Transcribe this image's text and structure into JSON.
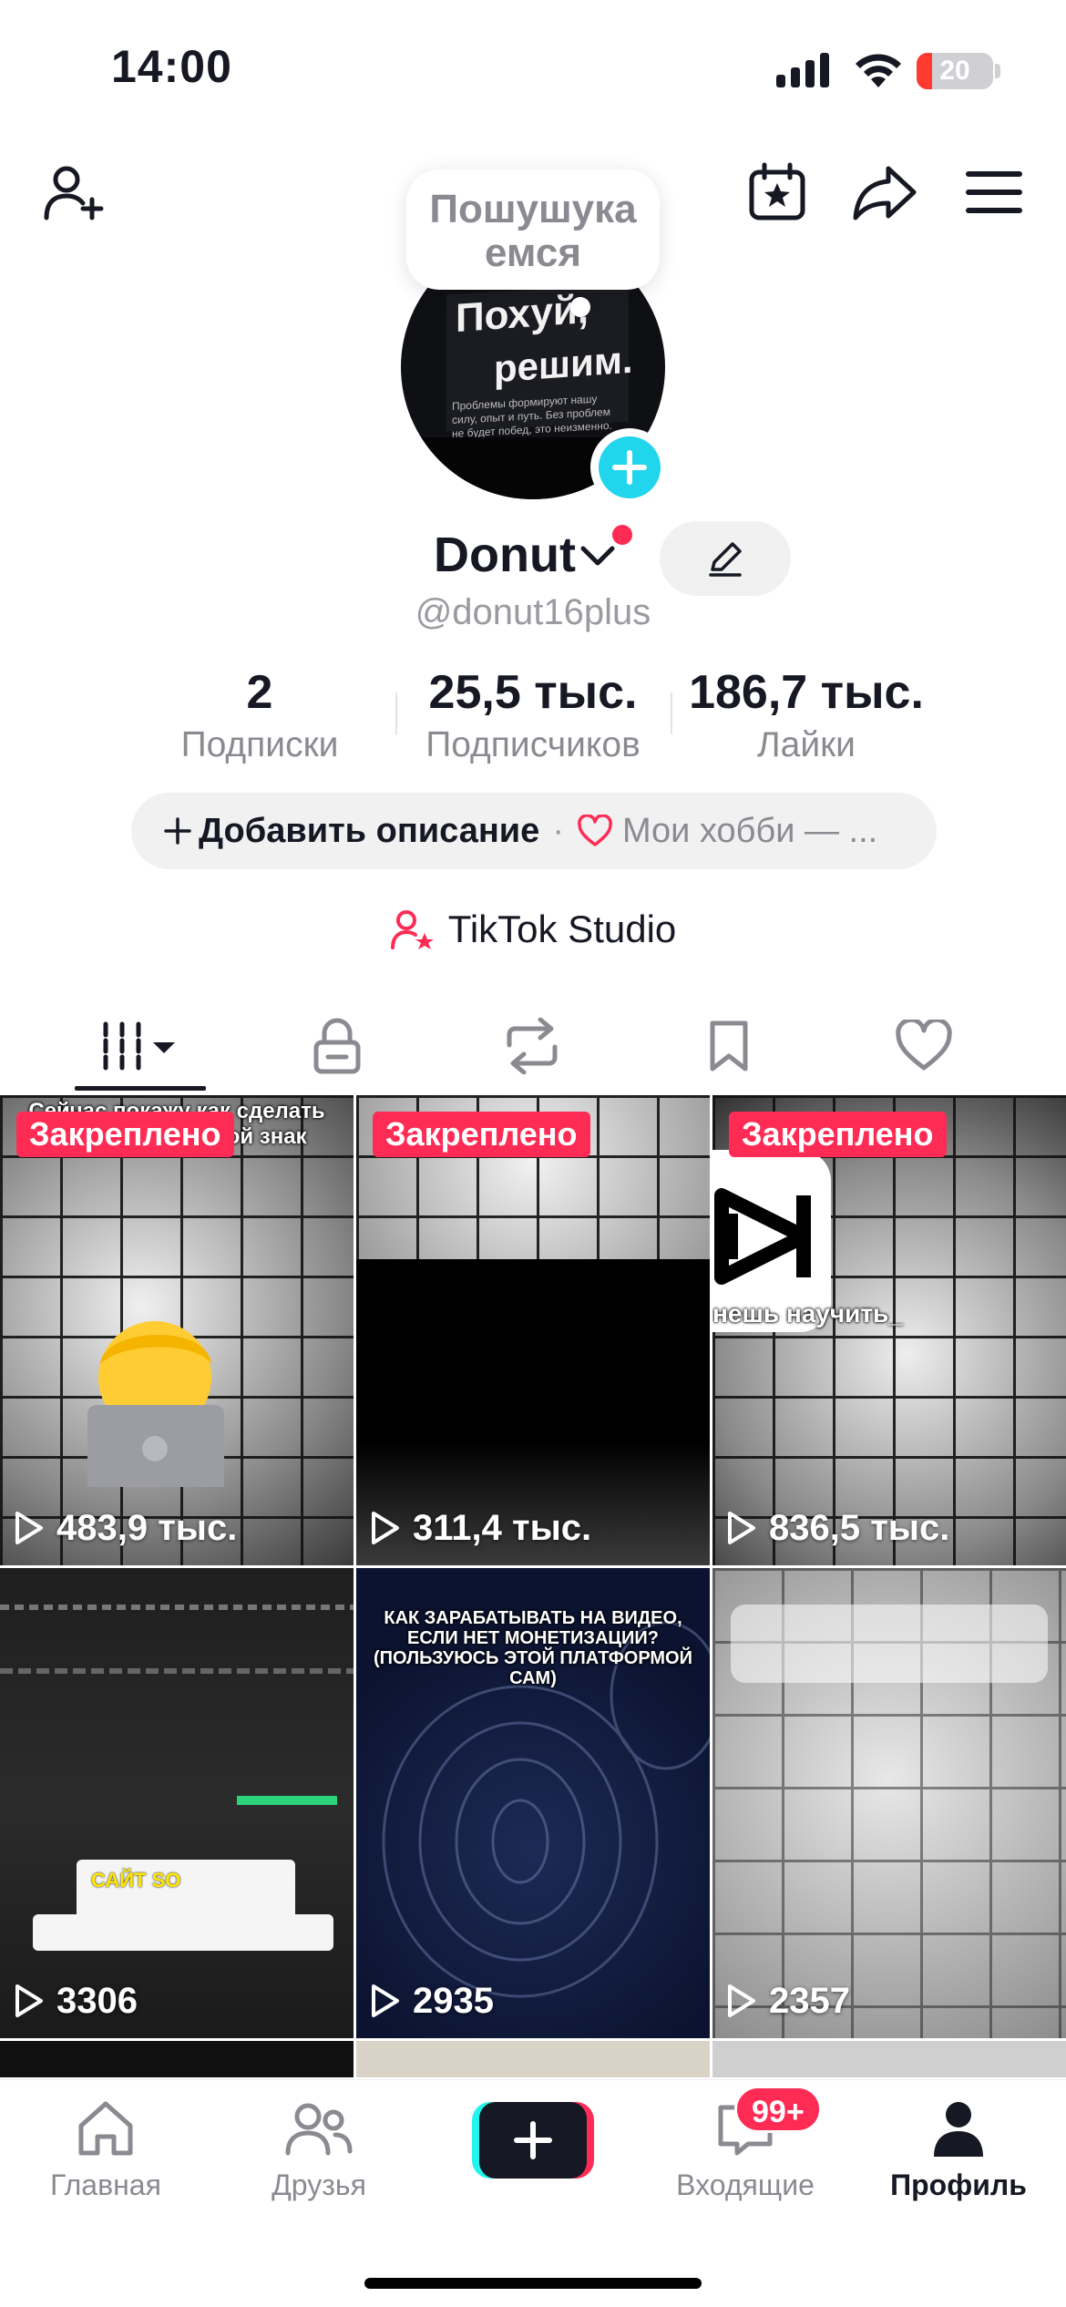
{
  "status_bar": {
    "time": "14:00",
    "battery": "20",
    "battery_level": 0.2
  },
  "note_bubble": {
    "line1": "Пошушука",
    "line2": "емся"
  },
  "avatar": {
    "line1": "Похуй,",
    "line2": "решим.",
    "small_text": "Проблемы формируют нашу силу, опыт и путь. Без проблем не будет побед, это неизменно."
  },
  "profile": {
    "display_name": "Donut",
    "username": "@donut16plus"
  },
  "stats": [
    {
      "value": "2",
      "label": "Подписки"
    },
    {
      "value": "25,5 тыс.",
      "label": "Подписчиков"
    },
    {
      "value": "186,7 тыс.",
      "label": "Лайки"
    }
  ],
  "bio": {
    "add_label": "Добавить описание",
    "separator": "·",
    "hobby_label": "Мои хобби — ..."
  },
  "studio": {
    "label": "TikTok Studio"
  },
  "tiles": [
    {
      "badge": "Закреплено",
      "views": "483,9 тыс.",
      "caption": "Сейчас покажу как сделать красивый водяной знак"
    },
    {
      "badge": "Закреплено",
      "views": "311,4 тыс.",
      "caption": ""
    },
    {
      "badge": "Закреплено",
      "views": "836,5 тыс.",
      "caption": "нешь научить_"
    },
    {
      "badge": "",
      "views": "3306",
      "caption": "САЙТ SO"
    },
    {
      "badge": "",
      "views": "2935",
      "caption": "КАК ЗАРАБАТЫВАТЬ НА ВИДЕО, ЕСЛИ НЕТ МОНЕТИЗАЦИИ? (ПОЛЬЗУЮСЬ ЭТОЙ ПЛАТФОРМОЙ САМ)"
    },
    {
      "badge": "",
      "views": "2357",
      "caption": ""
    }
  ],
  "bottom_nav": {
    "home": "Главная",
    "friends": "Друзья",
    "inbox": "Входящие",
    "inbox_badge": "99+",
    "profile": "Профиль"
  },
  "colors": {
    "accent": "#fe2c55",
    "cyan": "#20d5ec",
    "text": "#161823",
    "muted": "#8a8b91"
  }
}
